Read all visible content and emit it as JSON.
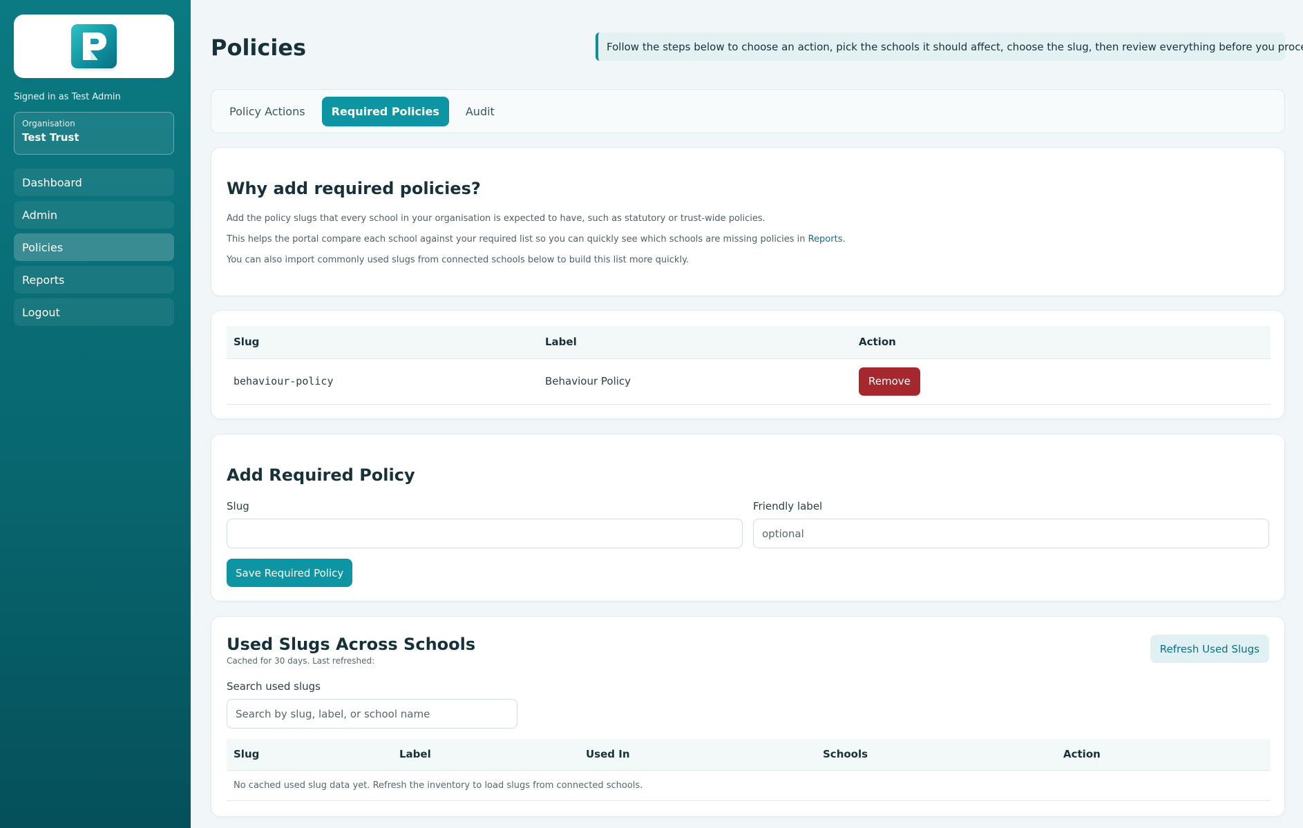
{
  "sidebar": {
    "signed_in": "Signed in as Test Admin",
    "org_label": "Organisation",
    "org_name": "Test Trust",
    "nav": [
      {
        "label": "Dashboard"
      },
      {
        "label": "Admin"
      },
      {
        "label": "Policies",
        "active": true
      },
      {
        "label": "Reports"
      },
      {
        "label": "Logout"
      }
    ]
  },
  "header": {
    "title": "Policies",
    "banner": "Follow the steps below to choose an action, pick the schools it should affect, choose the slug, then review everything before you proceed."
  },
  "tabs": [
    {
      "label": "Policy Actions"
    },
    {
      "label": "Required Policies",
      "active": true
    },
    {
      "label": "Audit"
    }
  ],
  "why": {
    "title": "Why add required policies?",
    "p1": "Add the policy slugs that every school in your organisation is expected to have, such as statutory or trust-wide policies.",
    "p2_before": "This helps the portal compare each school against your required list so you can quickly see which schools are missing policies in",
    "p2_link": "Reports",
    "p2_after": ".",
    "p3": "You can also import commonly used slugs from connected schools below to build this list more quickly."
  },
  "required_table": {
    "headers": [
      "Slug",
      "Label",
      "Action"
    ],
    "rows": [
      {
        "slug": "behaviour-policy",
        "label": "Behaviour Policy",
        "action": "Remove"
      }
    ]
  },
  "add_form": {
    "title": "Add Required Policy",
    "slug_label": "Slug",
    "slug_value": "",
    "label_label": "Friendly label",
    "label_placeholder": "optional",
    "save_label": "Save Required Policy"
  },
  "used": {
    "title": "Used Slugs Across Schools",
    "subtitle": "Cached for 30 days. Last refreshed:",
    "refresh_label": "Refresh Used Slugs",
    "search_label": "Search used slugs",
    "search_placeholder": "Search by slug, label, or school name",
    "headers": [
      "Slug",
      "Label",
      "Used In",
      "Schools",
      "Action"
    ],
    "empty": "No cached used slug data yet. Refresh the inventory to load slugs from connected schools."
  },
  "colors": {
    "sidebar": "#0b7a82",
    "primary": "#0e95a3",
    "danger": "#a4282d"
  }
}
